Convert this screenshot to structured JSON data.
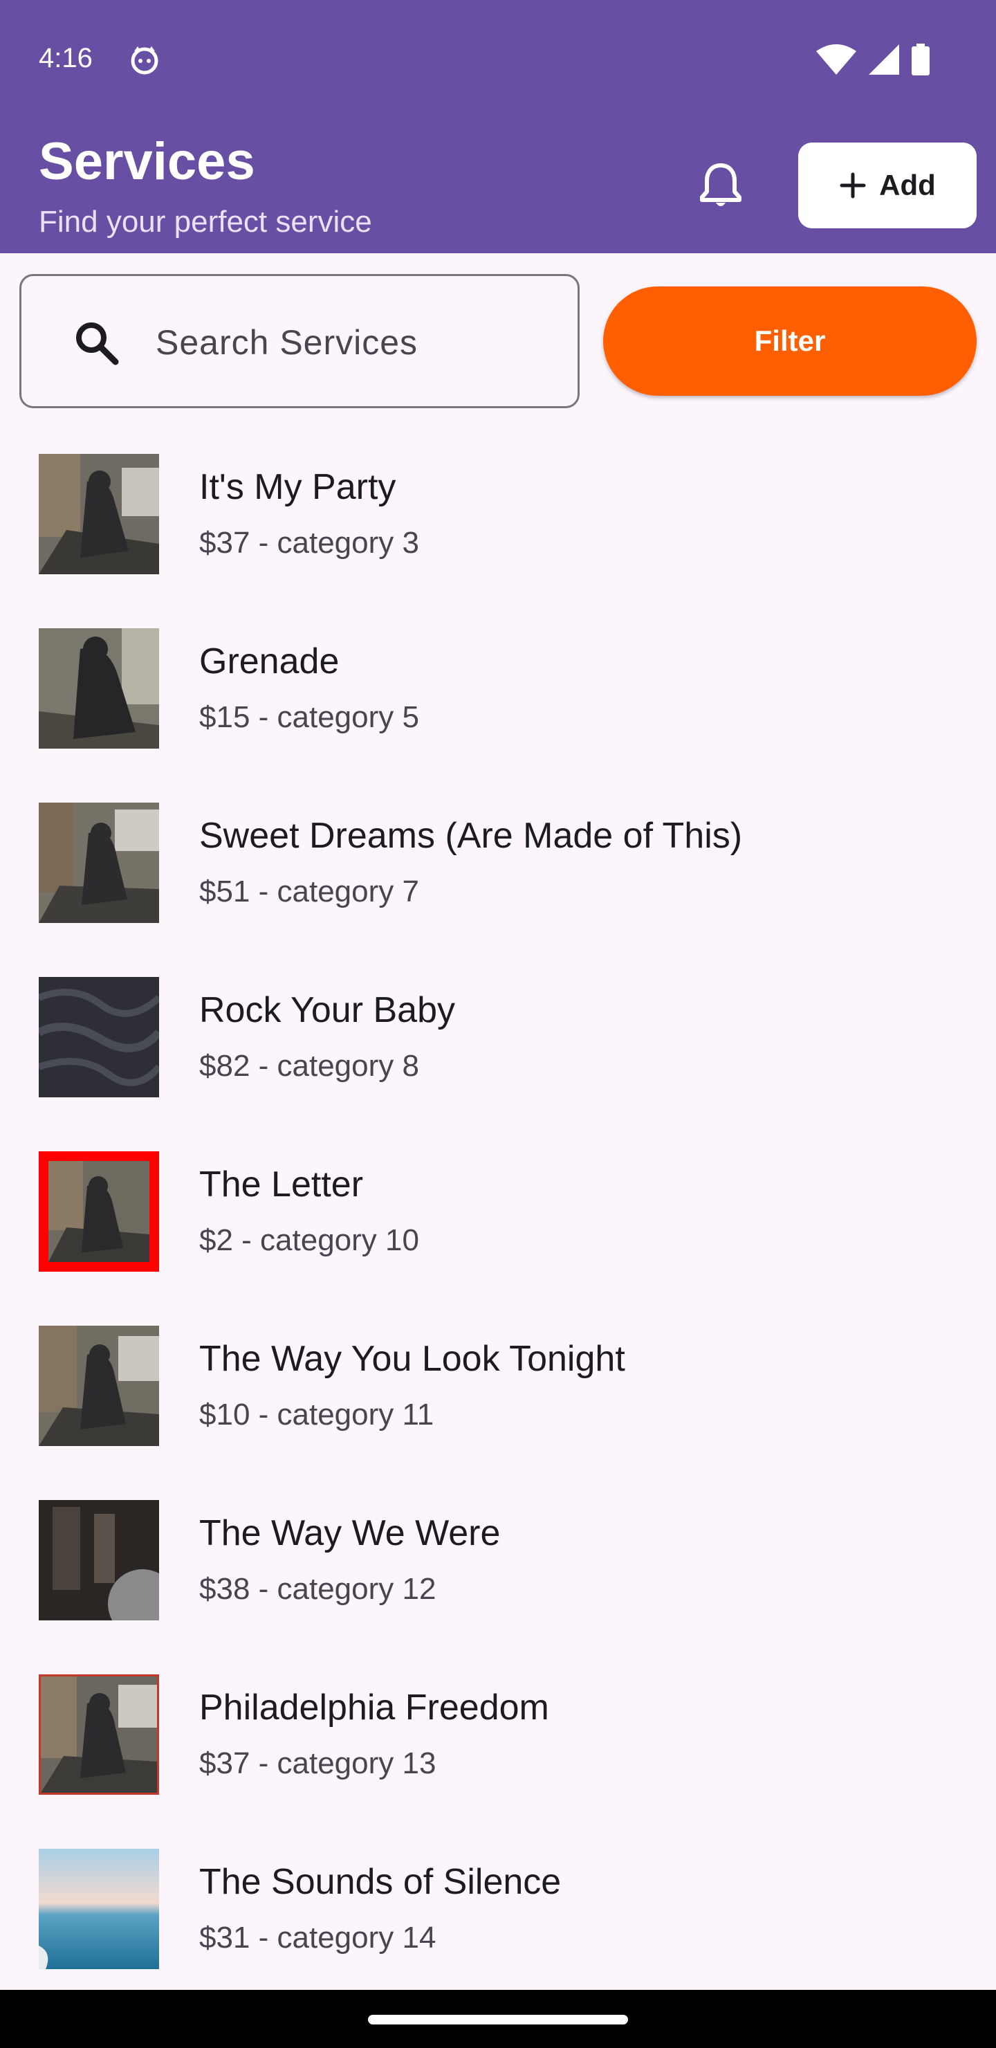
{
  "status_bar": {
    "time": "4:16"
  },
  "header": {
    "title": "Services",
    "subtitle": "Find your perfect service",
    "add_label": "Add"
  },
  "search": {
    "placeholder": "Search Services",
    "value": ""
  },
  "filter": {
    "label": "Filter"
  },
  "services": [
    {
      "title": "It's My Party",
      "subtitle": "$37 - category 3"
    },
    {
      "title": "Grenade",
      "subtitle": "$15 - category 5"
    },
    {
      "title": "Sweet Dreams (Are Made of This)",
      "subtitle": "$51 - category 7"
    },
    {
      "title": "Rock Your Baby",
      "subtitle": "$82 - category 8"
    },
    {
      "title": "The Letter",
      "subtitle": "$2 - category 10"
    },
    {
      "title": "The Way You Look Tonight",
      "subtitle": "$10 - category 11"
    },
    {
      "title": "The Way We Were",
      "subtitle": "$38 - category 12"
    },
    {
      "title": "Philadelphia Freedom",
      "subtitle": "$37 - category 13"
    },
    {
      "title": "The Sounds of Silence",
      "subtitle": "$31 - category 14"
    }
  ],
  "colors": {
    "header_bg": "#6750A4",
    "filter_bg": "#FF5F00",
    "page_bg": "#FCF5FC"
  }
}
